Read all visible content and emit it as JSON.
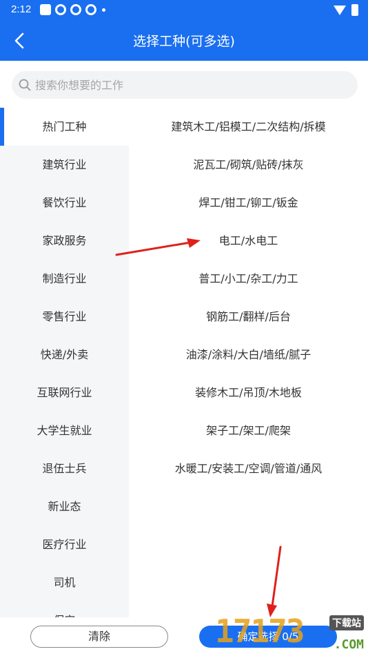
{
  "status_bar": {
    "time": "2:12"
  },
  "header": {
    "title": "选择工种(可多选)"
  },
  "search": {
    "placeholder": "搜索你想要的工作"
  },
  "sidebar": {
    "items": [
      "热门工种",
      "建筑行业",
      "餐饮行业",
      "家政服务",
      "制造行业",
      "零售行业",
      "快递/外卖",
      "互联网行业",
      "大学生就业",
      "退伍士兵",
      "新业态",
      "医疗行业",
      "司机",
      "保安"
    ],
    "active_index": 0
  },
  "jobs": [
    "建筑木工/铝模工/二次结构/拆模",
    "泥瓦工/砌筑/贴砖/抹灰",
    "焊工/钳工/铆工/钣金",
    "电工/水电工",
    "普工/小工/杂工/力工",
    "钢筋工/翻样/后台",
    "油漆/涂料/大白/墙纸/腻子",
    "装修木工/吊顶/木地板",
    "架子工/架工/爬架",
    "水暖工/安装工/空调/管道/通风"
  ],
  "footer": {
    "clear_label": "清除",
    "confirm_label": "确定选择 0/5"
  },
  "watermark": {
    "number": "17173",
    "sub": "下载站",
    "suffix": ".COM"
  },
  "colors": {
    "primary": "#1a6ff0",
    "annotation_arrow": "#e0201a"
  }
}
